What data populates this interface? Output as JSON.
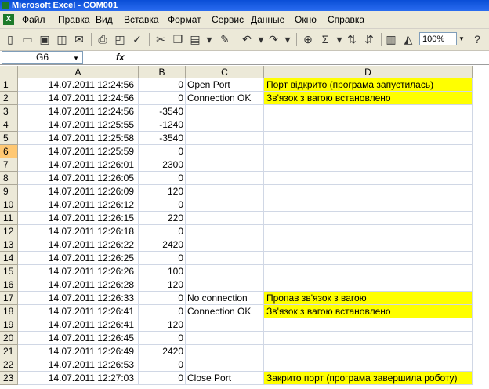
{
  "window": {
    "title": "Microsoft Excel - COM001"
  },
  "menu": [
    "Файл",
    "Правка",
    "Вид",
    "Вставка",
    "Формат",
    "Сервис",
    "Данные",
    "Окно",
    "Справка"
  ],
  "toolbar": {
    "zoom": "100%"
  },
  "formula_bar": {
    "name_box": "G6",
    "fx": "fx",
    "value": ""
  },
  "columns": [
    "A",
    "B",
    "C",
    "D"
  ],
  "rows": [
    {
      "n": "1",
      "a": "14.07.2011 12:24:56",
      "b": "0",
      "c": "Open Port",
      "d": "Порт відкрито (програма запустилась)"
    },
    {
      "n": "2",
      "a": "14.07.2011 12:24:56",
      "b": "0",
      "c": "Connection OK",
      "d": "Зв'язок з вагою встановлено"
    },
    {
      "n": "3",
      "a": "14.07.2011 12:24:56",
      "b": "-3540",
      "c": "",
      "d": ""
    },
    {
      "n": "4",
      "a": "14.07.2011 12:25:55",
      "b": "-1240",
      "c": "",
      "d": ""
    },
    {
      "n": "5",
      "a": "14.07.2011 12:25:58",
      "b": "-3540",
      "c": "",
      "d": ""
    },
    {
      "n": "6",
      "a": "14.07.2011 12:25:59",
      "b": "0",
      "c": "",
      "d": ""
    },
    {
      "n": "7",
      "a": "14.07.2011 12:26:01",
      "b": "2300",
      "c": "",
      "d": ""
    },
    {
      "n": "8",
      "a": "14.07.2011 12:26:05",
      "b": "0",
      "c": "",
      "d": ""
    },
    {
      "n": "9",
      "a": "14.07.2011 12:26:09",
      "b": "120",
      "c": "",
      "d": ""
    },
    {
      "n": "10",
      "a": "14.07.2011 12:26:12",
      "b": "0",
      "c": "",
      "d": ""
    },
    {
      "n": "11",
      "a": "14.07.2011 12:26:15",
      "b": "220",
      "c": "",
      "d": ""
    },
    {
      "n": "12",
      "a": "14.07.2011 12:26:18",
      "b": "0",
      "c": "",
      "d": ""
    },
    {
      "n": "13",
      "a": "14.07.2011 12:26:22",
      "b": "2420",
      "c": "",
      "d": ""
    },
    {
      "n": "14",
      "a": "14.07.2011 12:26:25",
      "b": "0",
      "c": "",
      "d": ""
    },
    {
      "n": "15",
      "a": "14.07.2011 12:26:26",
      "b": "100",
      "c": "",
      "d": ""
    },
    {
      "n": "16",
      "a": "14.07.2011 12:26:28",
      "b": "120",
      "c": "",
      "d": ""
    },
    {
      "n": "17",
      "a": "14.07.2011 12:26:33",
      "b": "0",
      "c": "No connection",
      "d": "Пропав зв'язок з вагою"
    },
    {
      "n": "18",
      "a": "14.07.2011 12:26:41",
      "b": "0",
      "c": "Connection OK",
      "d": "Зв'язок з вагою встановлено"
    },
    {
      "n": "19",
      "a": "14.07.2011 12:26:41",
      "b": "120",
      "c": "",
      "d": ""
    },
    {
      "n": "20",
      "a": "14.07.2011 12:26:45",
      "b": "0",
      "c": "",
      "d": ""
    },
    {
      "n": "21",
      "a": "14.07.2011 12:26:49",
      "b": "2420",
      "c": "",
      "d": ""
    },
    {
      "n": "22",
      "a": "14.07.2011 12:26:53",
      "b": "0",
      "c": "",
      "d": ""
    },
    {
      "n": "23",
      "a": "14.07.2011 12:27:03",
      "b": "0",
      "c": "Close Port",
      "d": "Закрито порт (програма завершила роботу)"
    }
  ],
  "highlighted_rows": [
    "1",
    "2",
    "17",
    "18",
    "23"
  ],
  "active_row": "6",
  "highlight_color": "#ffff00"
}
